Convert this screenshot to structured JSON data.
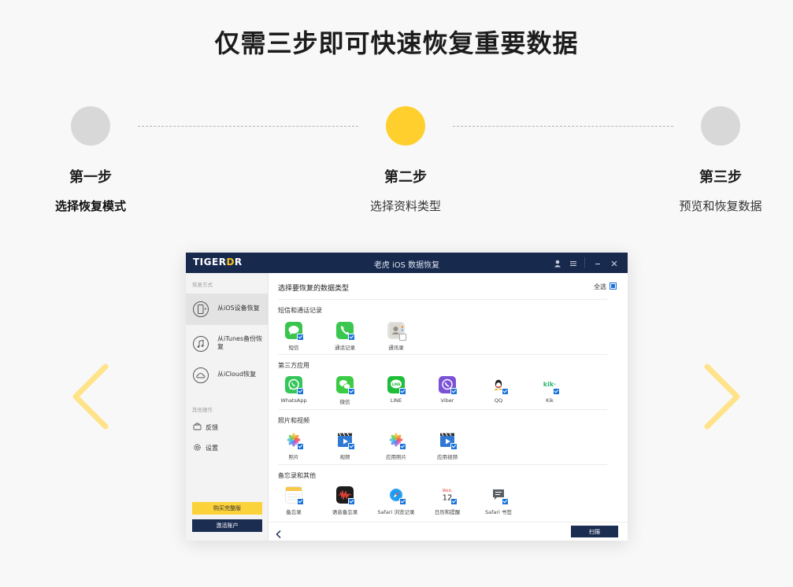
{
  "headline": "仅需三步即可快速恢复重要数据",
  "steps": [
    {
      "title": "第一步",
      "desc": "选择恢复模式",
      "state": "done"
    },
    {
      "title": "第二步",
      "desc": "选择资料类型",
      "state": "current"
    },
    {
      "title": "第三步",
      "desc": "预览和恢复数据",
      "state": "pending"
    }
  ],
  "colors": {
    "accent_yellow": "#ffcf2e",
    "step_gray": "#d8d8d8",
    "navy": "#17294d",
    "check_blue": "#1a73d9",
    "arrow_yellow": "#ffe38a"
  },
  "nav": {
    "prev_icon": "chevron-left-icon",
    "next_icon": "chevron-right-icon"
  },
  "app_window": {
    "logo_prefix": "TIGER",
    "logo_accent": "D",
    "logo_suffix": "R",
    "title": "老虎 iOS 数据恢复",
    "sidebar": {
      "section_recovery": "恢复方式",
      "modes": [
        {
          "label": "从iOS设备恢复",
          "icon": "phone-refresh-icon",
          "active": true
        },
        {
          "label": "从iTunes备份恢复",
          "icon": "music-note-icon",
          "active": false
        },
        {
          "label": "从iCloud恢复",
          "icon": "cloud-icon",
          "active": false
        }
      ],
      "section_other": "其他操作",
      "links": [
        {
          "label": "反馈",
          "icon": "feedback-icon"
        },
        {
          "label": "设置",
          "icon": "gear-icon"
        }
      ],
      "buy_label": "购买完整版",
      "activate_label": "激活账户"
    },
    "main": {
      "header": "选择要恢复的数据类型",
      "select_all": "全选",
      "categories": [
        {
          "title": "短信和通话记录",
          "items": [
            {
              "name": "短信",
              "icon": "messages-icon",
              "checked": true
            },
            {
              "name": "通话记录",
              "icon": "phone-icon",
              "checked": true
            },
            {
              "name": "通讯录",
              "icon": "contacts-icon",
              "checked": false
            }
          ]
        },
        {
          "title": "第三方应用",
          "items": [
            {
              "name": "WhatsApp",
              "icon": "whatsapp-icon",
              "checked": true
            },
            {
              "name": "微信",
              "icon": "wechat-icon",
              "checked": true
            },
            {
              "name": "LINE",
              "icon": "line-icon",
              "checked": true
            },
            {
              "name": "Viber",
              "icon": "viber-icon",
              "checked": true
            },
            {
              "name": "QQ",
              "icon": "qq-icon",
              "checked": true
            },
            {
              "name": "Kik",
              "icon": "kik-icon",
              "checked": true
            }
          ]
        },
        {
          "title": "照片和视频",
          "items": [
            {
              "name": "照片",
              "icon": "photos-icon",
              "checked": true
            },
            {
              "name": "视频",
              "icon": "video-icon",
              "checked": true
            },
            {
              "name": "应用照片",
              "icon": "app-photos-icon",
              "checked": true
            },
            {
              "name": "应用视频",
              "icon": "app-video-icon",
              "checked": true
            }
          ]
        },
        {
          "title": "备忘录和其他",
          "items": [
            {
              "name": "备忘录",
              "icon": "notes-icon",
              "checked": true
            },
            {
              "name": "语音备忘录",
              "icon": "voice-memo-icon",
              "checked": true
            },
            {
              "name": "Safari 浏览记录",
              "icon": "safari-icon",
              "checked": true
            },
            {
              "name": "日历和提醒",
              "icon": "calendar-icon",
              "checked": true,
              "cal_day": "Wed.",
              "cal_date": "12"
            },
            {
              "name": "Safari 书签",
              "icon": "bookmark-icon",
              "checked": true
            }
          ]
        }
      ],
      "scan_label": "扫描"
    }
  }
}
